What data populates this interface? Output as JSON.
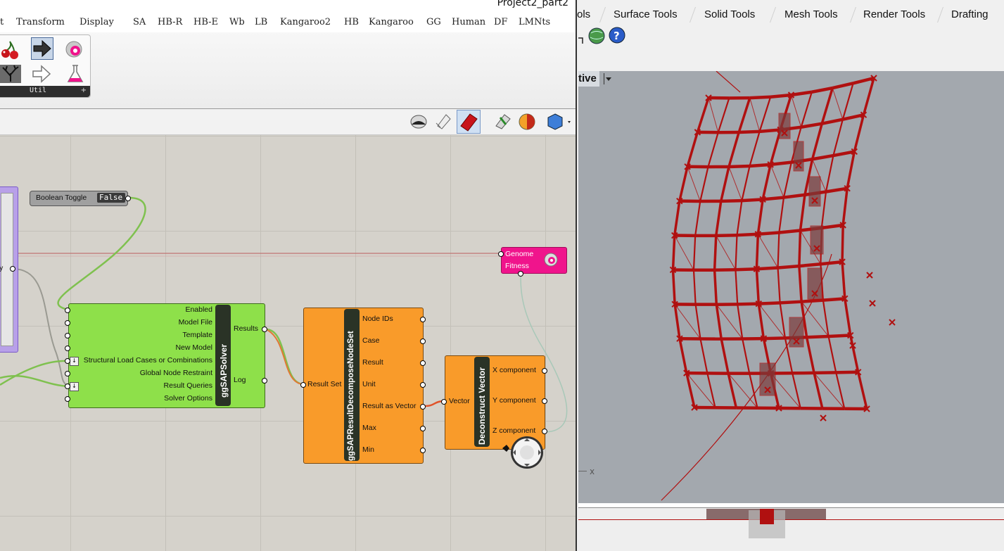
{
  "grasshopper": {
    "window_title": "Project2_part2",
    "tabs": [
      "t",
      "Transform",
      "Display",
      "SA",
      "HB-R",
      "HB-E",
      "Wb",
      "LB",
      "Kangaroo2",
      "HB",
      "Kangaroo",
      "GG",
      "Human",
      "DF",
      "LMNts"
    ],
    "ribbon_group": "Util",
    "boolean_toggle": {
      "label": "Boolean Toggle",
      "value": "False"
    },
    "partial_output": "y",
    "galapagos": {
      "genome": "Genome",
      "fitness": "Fitness"
    },
    "solver": {
      "name": "ggSAPSolver",
      "inputs": [
        "Enabled",
        "Model File",
        "Template",
        "New Model",
        "Structural Load Cases or Combinations",
        "Global Node Restraint",
        "Result Queries",
        "Solver Options"
      ],
      "outputs": [
        "Results",
        "Log"
      ]
    },
    "decompose": {
      "name": "ggSAPResultDecomposeNodeSet",
      "inputs": [
        "Result Set"
      ],
      "outputs": [
        "Node IDs",
        "Case",
        "Result",
        "Unit",
        "Result as Vector",
        "Max",
        "Min"
      ]
    },
    "deconstruct": {
      "name": "Deconstruct Vector",
      "inputs": [
        "Vector"
      ],
      "outputs": [
        "X component",
        "Y component",
        "Z component"
      ]
    }
  },
  "rhino": {
    "tabs": [
      "ols",
      "Surface Tools",
      "Solid Tools",
      "Mesh Tools",
      "Render Tools",
      "Drafting"
    ],
    "viewport_label": "tive",
    "axis_label": "x"
  },
  "colors": {
    "gh_green": "#8ee04a",
    "gh_orange": "#f99b2a",
    "gh_pink": "#f0148c",
    "structure_red": "#b01010",
    "viewport_bg": "#a3a8ae",
    "canvas_bg": "#d5d2cb"
  }
}
